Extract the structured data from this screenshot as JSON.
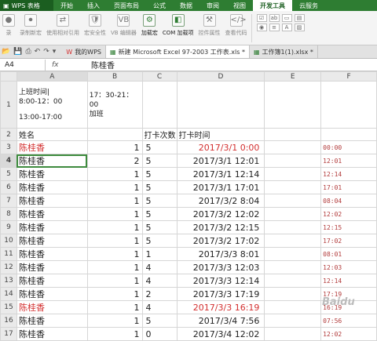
{
  "menubar": {
    "brand": "WPS 表格",
    "items": [
      "开始",
      "插入",
      "页面布局",
      "公式",
      "数据",
      "审阅",
      "视图",
      "开发工具",
      "云服务"
    ],
    "active_index": 7
  },
  "ribbon": {
    "buttons": [
      {
        "label": "录",
        "strong": false
      },
      {
        "label": "录制新宏",
        "strong": false
      },
      {
        "label": "使用相对引用",
        "strong": false
      },
      {
        "label": "宏安全性",
        "strong": false
      },
      {
        "label": "VB 编辑器",
        "strong": false
      },
      {
        "label": "加载宏",
        "strong": true
      },
      {
        "label": "COM 加载项",
        "strong": true
      },
      {
        "label": "控件属性",
        "strong": false
      },
      {
        "label": "查看代码",
        "strong": false
      }
    ]
  },
  "tabs": [
    {
      "label": "我的WPS",
      "active": false,
      "icon": "wps-icon"
    },
    {
      "label": "新建 Microsoft Excel 97-2003 工作表.xls *",
      "active": true,
      "icon": "sheet-icon"
    },
    {
      "label": "工作簿1(1).xlsx *",
      "active": false,
      "icon": "sheet-icon"
    }
  ],
  "formula_bar": {
    "cell_ref": "A4",
    "fx": "fx",
    "value": "陈桂香"
  },
  "grid": {
    "columns": [
      "A",
      "B",
      "C",
      "D",
      "E",
      "F"
    ],
    "row1": {
      "num": "1",
      "a_line1": "上班时间|",
      "a_line2": "8:00-12：00",
      "a_line3": "13:00-17:00",
      "b_line1": "17：30-21：00",
      "b_line2": "加班"
    },
    "row2": {
      "num": "2",
      "a": "姓名",
      "c": "打卡次数",
      "d": "打卡时间"
    },
    "rows": [
      {
        "num": "3",
        "name": "陈桂香",
        "b": "1",
        "c": "5",
        "d": "2017/3/1  0:00",
        "f": "00:00",
        "red": true
      },
      {
        "num": "4",
        "name": "陈桂香",
        "b": "2",
        "c": "5",
        "d": "2017/3/1 12:01",
        "f": "12:01",
        "red": false
      },
      {
        "num": "5",
        "name": "陈桂香",
        "b": "1",
        "c": "5",
        "d": "2017/3/1 12:14",
        "f": "12:14",
        "red": false
      },
      {
        "num": "6",
        "name": "陈桂香",
        "b": "1",
        "c": "5",
        "d": "2017/3/1 17:01",
        "f": "17:01",
        "red": false
      },
      {
        "num": "7",
        "name": "陈桂香",
        "b": "1",
        "c": "5",
        "d": "2017/3/2  8:04",
        "f": "08:04",
        "red": false
      },
      {
        "num": "8",
        "name": "陈桂香",
        "b": "1",
        "c": "5",
        "d": "2017/3/2 12:02",
        "f": "12:02",
        "red": false
      },
      {
        "num": "9",
        "name": "陈桂香",
        "b": "1",
        "c": "5",
        "d": "2017/3/2 12:15",
        "f": "12:15",
        "red": false
      },
      {
        "num": "10",
        "name": "陈桂香",
        "b": "1",
        "c": "5",
        "d": "2017/3/2 17:02",
        "f": "17:02",
        "red": false
      },
      {
        "num": "11",
        "name": "陈桂香",
        "b": "1",
        "c": "1",
        "d": "2017/3/3  8:01",
        "f": "08:01",
        "red": false
      },
      {
        "num": "12",
        "name": "陈桂香",
        "b": "1",
        "c": "4",
        "d": "2017/3/3 12:03",
        "f": "12:03",
        "red": false
      },
      {
        "num": "13",
        "name": "陈桂香",
        "b": "1",
        "c": "4",
        "d": "2017/3/3 12:14",
        "f": "12:14",
        "red": false
      },
      {
        "num": "14",
        "name": "陈桂香",
        "b": "1",
        "c": "2",
        "d": "2017/3/3 17:19",
        "f": "17:19",
        "red": false
      },
      {
        "num": "15",
        "name": "陈桂香",
        "b": "1",
        "c": "4",
        "d": "2017/3/3 16:19",
        "f": "16:19",
        "red": true
      },
      {
        "num": "16",
        "name": "陈桂香",
        "b": "1",
        "c": "5",
        "d": "2017/3/4  7:56",
        "f": "07:56",
        "red": false
      },
      {
        "num": "17",
        "name": "陈桂香",
        "b": "1",
        "c": "0",
        "d": "2017/3/4 12:02",
        "f": "12:02",
        "red": false
      }
    ],
    "active_row": "4"
  },
  "watermark": "Baidu"
}
